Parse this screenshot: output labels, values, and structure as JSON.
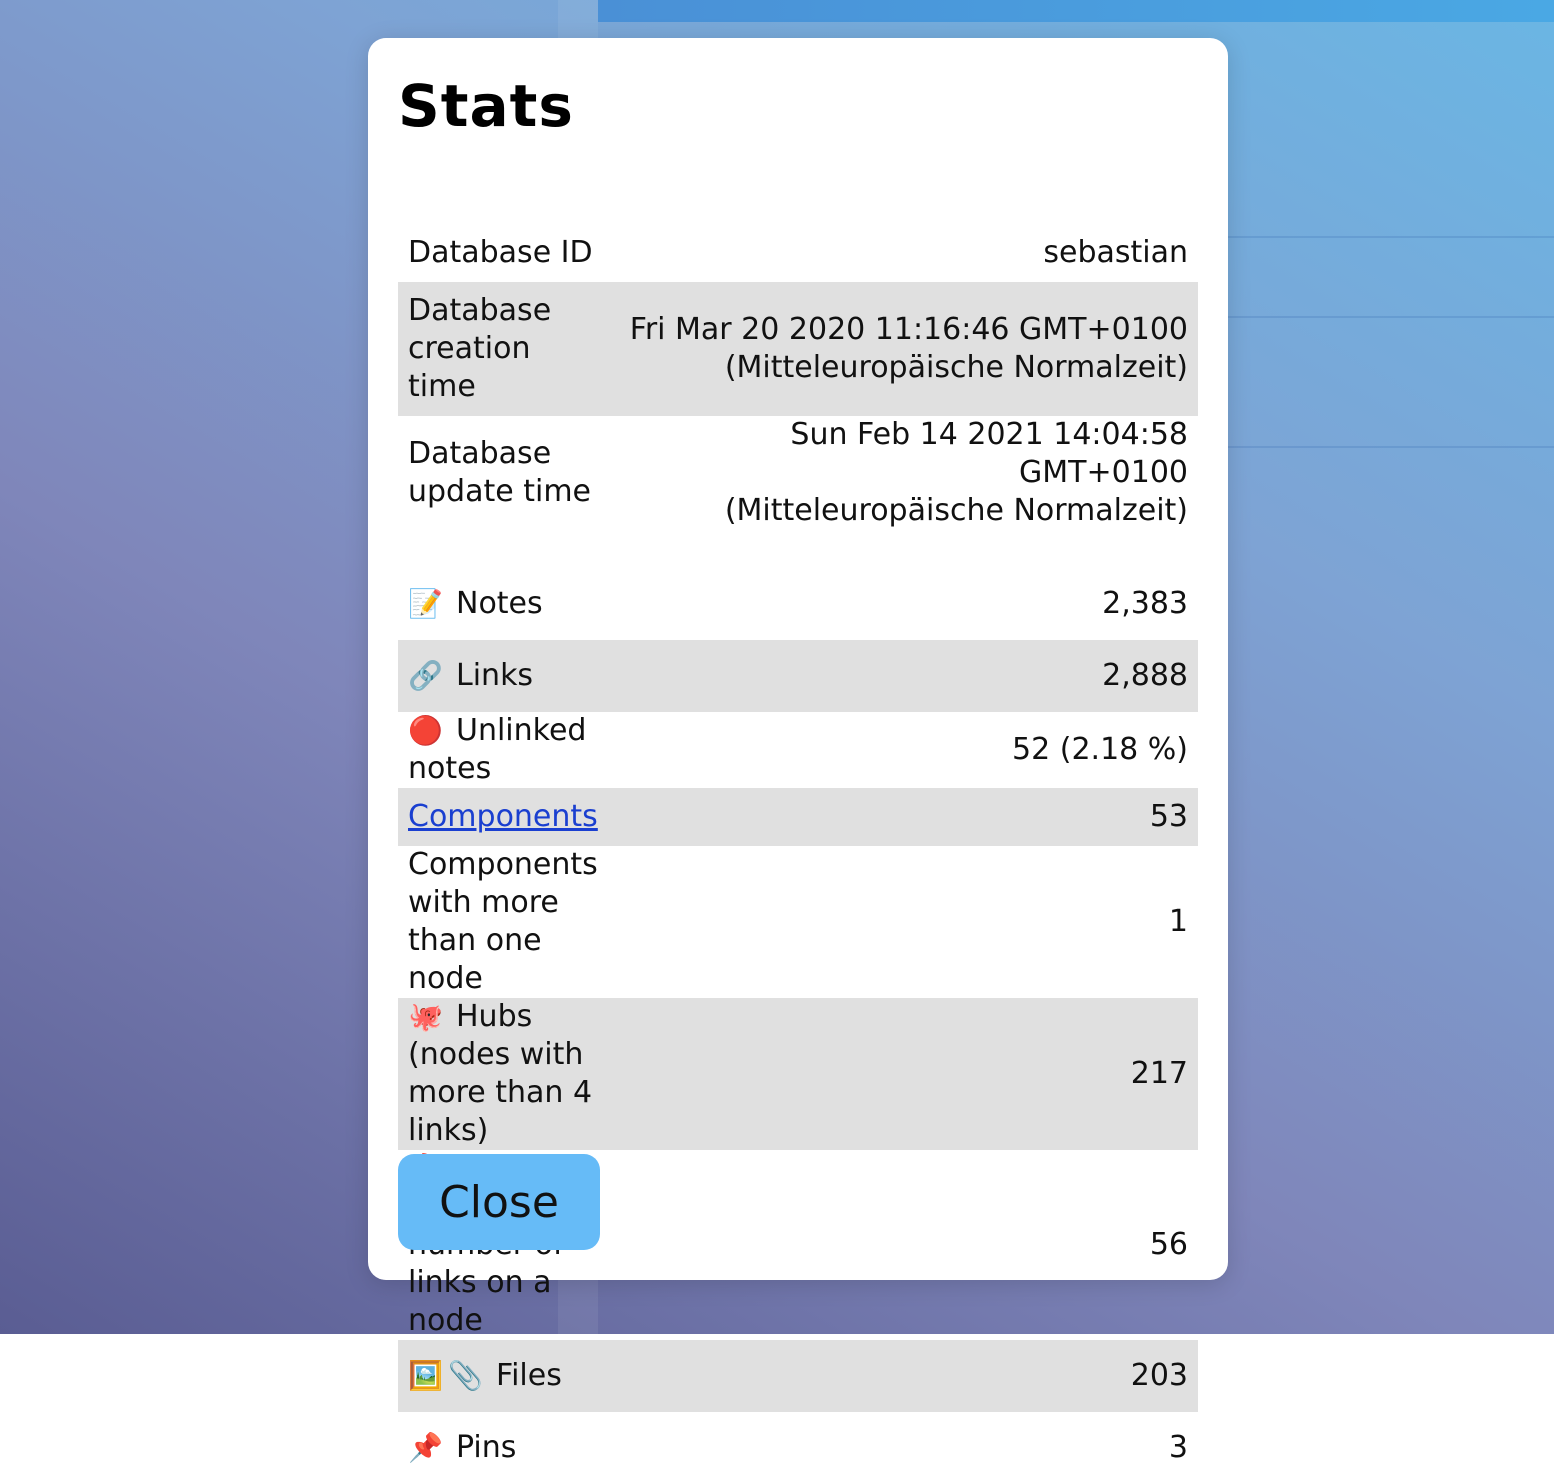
{
  "dialog": {
    "title": "Stats",
    "close_label": "Close"
  },
  "db_info": [
    {
      "label": "Database ID",
      "value": "sebastian"
    },
    {
      "label": "Database creation time",
      "value_line1": "Fri Mar 20 2020 11:16:46 GMT+0100",
      "value_line2": "(Mitteleuropäische Normalzeit)"
    },
    {
      "label": "Database update time",
      "value_line1": "Sun Feb 14 2021 14:04:58 GMT+0100",
      "value_line2": "(Mitteleuropäische Normalzeit)"
    }
  ],
  "stats": [
    {
      "icon": "📝",
      "icon_name": "memo-icon",
      "label": "Notes",
      "value": "2,383"
    },
    {
      "icon": "🔗",
      "icon_name": "link-icon",
      "label": "Links",
      "value": "2,888"
    },
    {
      "icon": "🔴",
      "icon_name": "red-circle-icon",
      "label": "Unlinked notes",
      "value": "52 (2.18 %)"
    },
    {
      "label": "Components",
      "value": "53",
      "is_link": true
    },
    {
      "label": "Components with more than one node",
      "value": "1"
    },
    {
      "icon": "🐙",
      "icon_name": "octopus-icon",
      "label": "Hubs (nodes with more than 4 links)",
      "value": "217"
    },
    {
      "icon": "🔥",
      "icon_name": "fire-icon",
      "label": "Maximum number of links on a node",
      "value": "56"
    },
    {
      "icon": "🖼️",
      "icon_name": "framed-picture-icon",
      "icon2": "📎",
      "icon2_name": "paperclip-icon",
      "label": "Files",
      "value": "203"
    },
    {
      "icon": "📌",
      "icon_name": "pushpin-icon",
      "label": "Pins",
      "value": "3"
    }
  ]
}
